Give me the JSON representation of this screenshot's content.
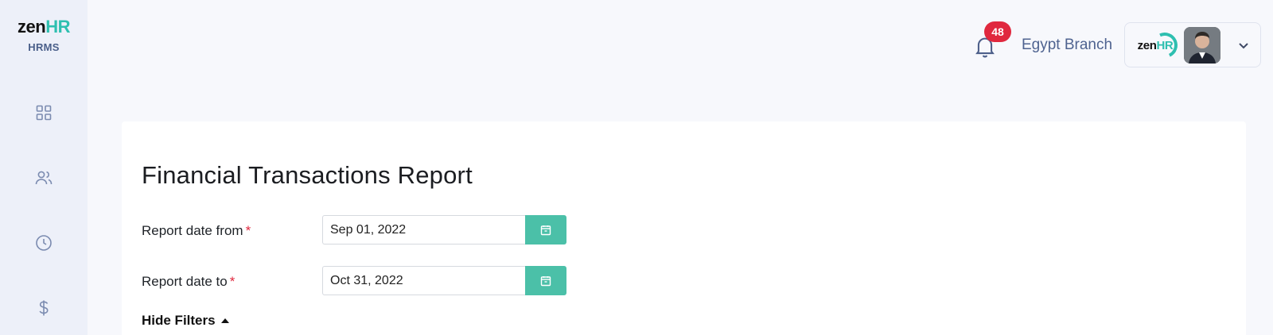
{
  "sidebar": {
    "logo": {
      "brand_main": "zen",
      "brand_accent": "HR",
      "subtitle": "HRMS"
    },
    "nav_icons": [
      "dashboard-grid-icon",
      "people-icon",
      "clock-icon",
      "dollar-icon"
    ]
  },
  "header": {
    "notifications_count": "48",
    "branch_name": "Egypt Branch",
    "company_logo": {
      "brand_main": "zen",
      "brand_accent": "HR"
    }
  },
  "report": {
    "title": "Financial Transactions Report",
    "fields": [
      {
        "label": "Report date from",
        "required_mark": "*",
        "value": "Sep 01, 2022"
      },
      {
        "label": "Report date to",
        "required_mark": "*",
        "value": "Oct 31, 2022"
      }
    ],
    "toggle_filters_label": "Hide Filters"
  },
  "colors": {
    "accent_teal": "#4bc0a8",
    "brand_teal": "#2ebfb0",
    "badge_red": "#e0283e",
    "sidebar_bg": "#edf0f9"
  }
}
